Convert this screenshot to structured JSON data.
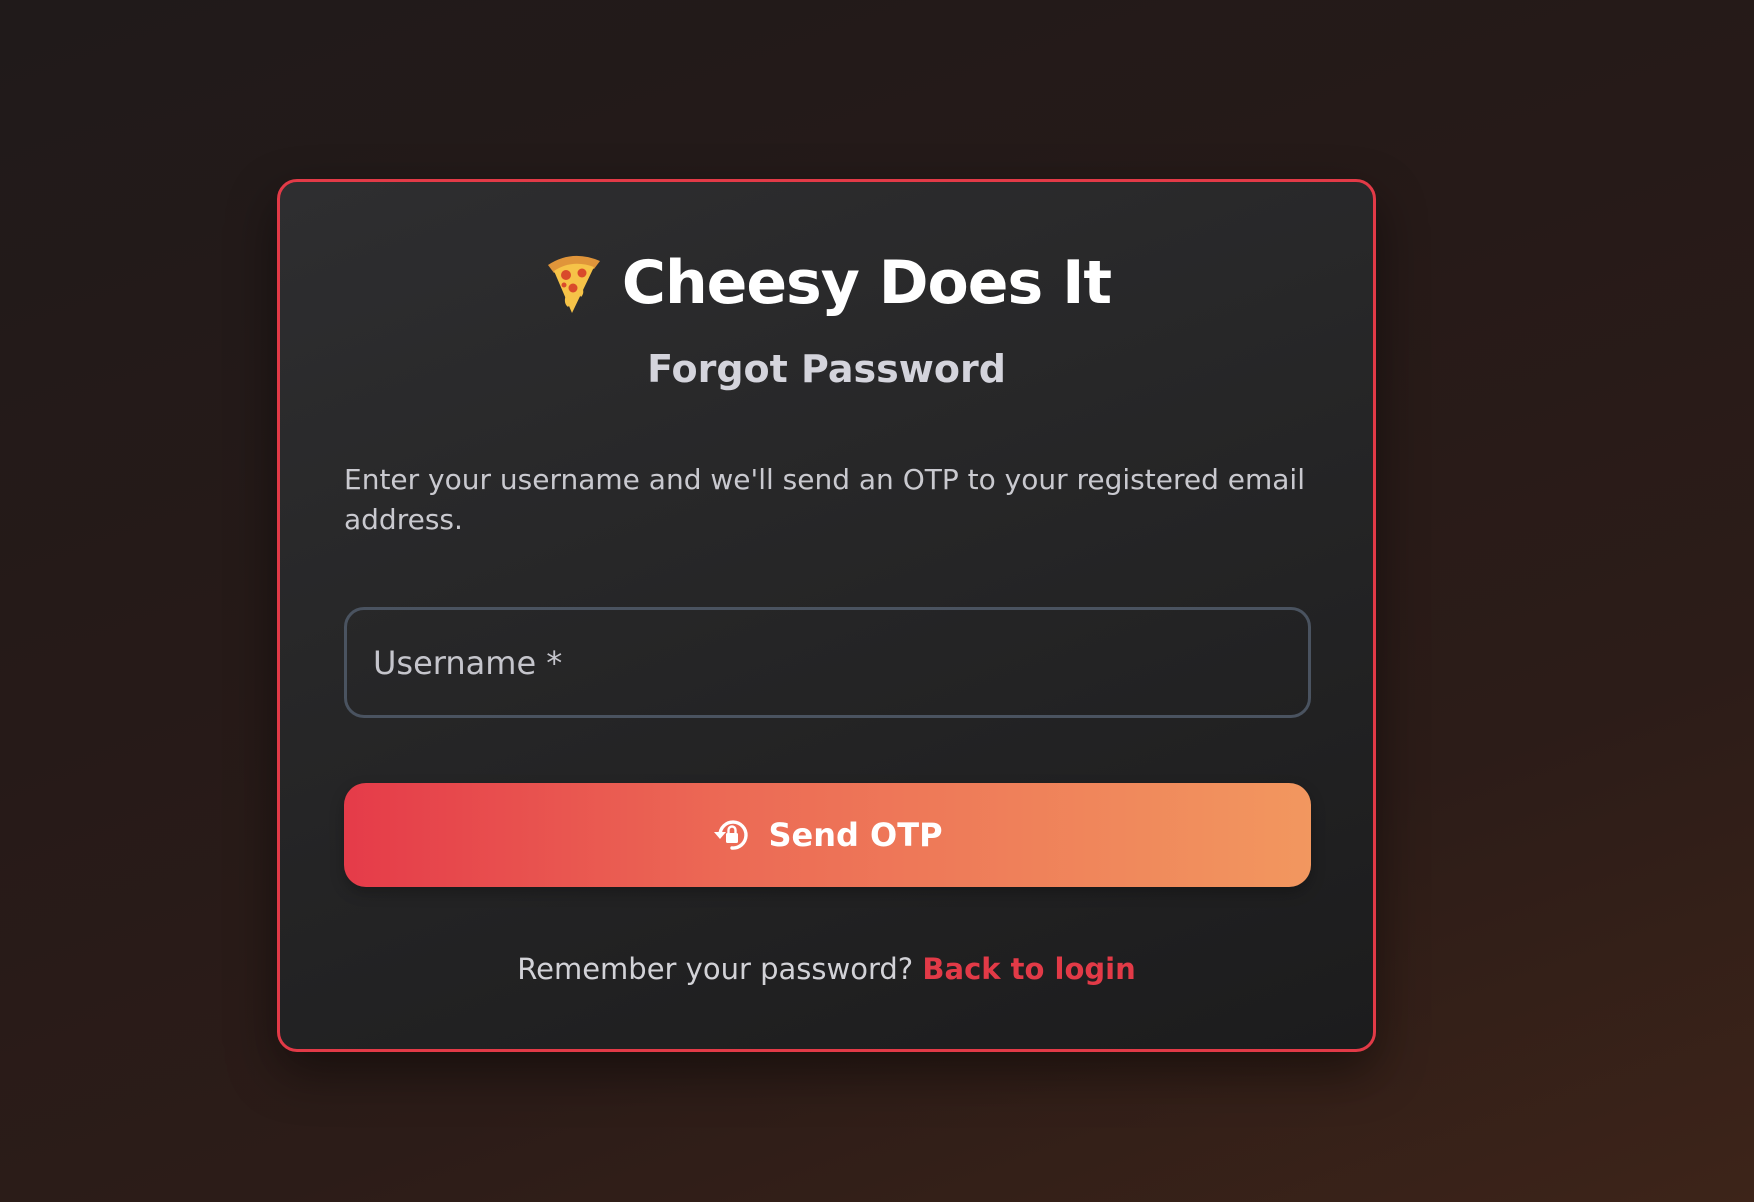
{
  "brand": {
    "icon": "pizza-icon",
    "title": "Cheesy Does It"
  },
  "page": {
    "subtitle": "Forgot Password",
    "description": "Enter your username and we'll send an OTP to your registered email address."
  },
  "form": {
    "username": {
      "label": "Username *",
      "value": ""
    },
    "submit": {
      "icon": "lock-reset-icon",
      "label": "Send OTP"
    }
  },
  "footer": {
    "prompt": "Remember your password?",
    "link_label": "Back to login"
  },
  "colors": {
    "accent": "#e23a47",
    "gradient_start": "#e53b49",
    "gradient_end": "#f2975f",
    "card_background": "#262627"
  }
}
